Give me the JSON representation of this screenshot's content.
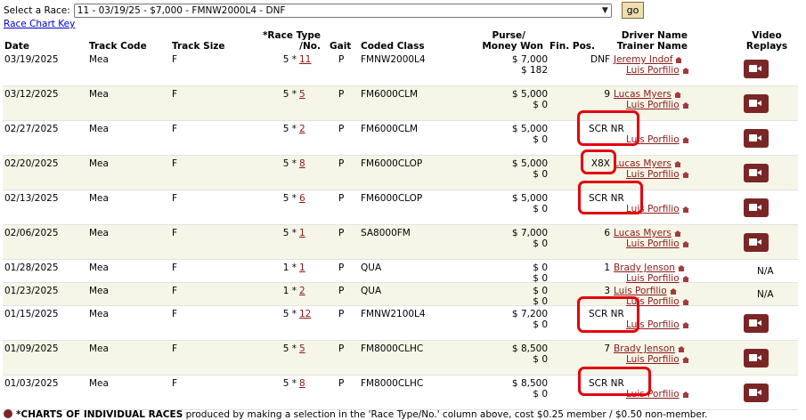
{
  "selector": {
    "label": "Select a Race:",
    "value": "11 - 03/19/25 - $7,000 - FMNW2000L4 - DNF",
    "go": "go"
  },
  "chart_key_link": "Race Chart Key",
  "headers": {
    "date": "Date",
    "track_code": "Track Code",
    "track_size": "Track Size",
    "race_type_1": "*Race Type",
    "race_type_2": "/No.",
    "gait": "Gait",
    "coded_class": "Coded Class",
    "purse_1": "Purse/",
    "purse_2": "Money Won",
    "fin_pos": "Fin. Pos.",
    "driver_1": "Driver Name",
    "driver_2": "Trainer Name",
    "video_1": "Video",
    "video_2": "Replays"
  },
  "rows": [
    {
      "date": "03/19/2025",
      "track": "Mea",
      "size": "F",
      "rt": "5 *",
      "no": "11",
      "gait": "P",
      "cls": "FMNW2000L4",
      "purse": "$ 7,000",
      "won": "$ 182",
      "fin": "DNF",
      "driver": "Jeremy Indof",
      "trainer": "Luis Porfilio",
      "video": true
    },
    {
      "date": "03/12/2025",
      "track": "Mea",
      "size": "F",
      "rt": "5 *",
      "no": "5",
      "gait": "P",
      "cls": "FM6000CLM",
      "purse": "$ 5,000",
      "won": "$ 0",
      "fin": "9",
      "driver": "Lucas Myers",
      "trainer": "Luis Porfilio",
      "video": true
    },
    {
      "date": "02/27/2025",
      "track": "Mea",
      "size": "F",
      "rt": "5 *",
      "no": "2",
      "gait": "P",
      "cls": "FM6000CLM",
      "purse": "$ 5,000",
      "won": "$ 0",
      "fin": "SCR NR",
      "driver": "",
      "trainer": "Luis Porfilio",
      "video": true
    },
    {
      "date": "02/20/2025",
      "track": "Mea",
      "size": "F",
      "rt": "5 *",
      "no": "8",
      "gait": "P",
      "cls": "FM6000CLOP",
      "purse": "$ 5,000",
      "won": "$ 0",
      "fin": "X8X",
      "driver": "Lucas Myers",
      "trainer": "Luis Porfilio",
      "video": true
    },
    {
      "date": "02/13/2025",
      "track": "Mea",
      "size": "F",
      "rt": "5 *",
      "no": "6",
      "gait": "P",
      "cls": "FM6000CLOP",
      "purse": "$ 5,000",
      "won": "$ 0",
      "fin": "SCR NR",
      "driver": "",
      "trainer": "Luis Porfilio",
      "video": true
    },
    {
      "date": "02/06/2025",
      "track": "Mea",
      "size": "F",
      "rt": "5 *",
      "no": "1",
      "gait": "P",
      "cls": "SA8000FM",
      "purse": "$ 7,000",
      "won": "$ 0",
      "fin": "6",
      "driver": "Lucas Myers",
      "trainer": "Luis Porfilio",
      "video": true
    },
    {
      "date": "01/28/2025",
      "track": "Mea",
      "size": "F",
      "rt": "1 *",
      "no": "1",
      "gait": "P",
      "cls": "QUA",
      "purse": "$ 0",
      "won": "$ 0",
      "fin": "1",
      "driver": "Brady Jenson",
      "trainer": "Luis Porfilio",
      "video": false,
      "na": "N/A"
    },
    {
      "date": "01/23/2025",
      "track": "Mea",
      "size": "F",
      "rt": "1 *",
      "no": "2",
      "gait": "P",
      "cls": "QUA",
      "purse": "$ 0",
      "won": "$ 0",
      "fin": "3",
      "driver": "Luis Porfilio",
      "trainer": "Luis Porfilio",
      "video": false,
      "na": "N/A"
    },
    {
      "date": "01/15/2025",
      "track": "Mea",
      "size": "F",
      "rt": "5 *",
      "no": "12",
      "gait": "P",
      "cls": "FMNW2100L4",
      "purse": "$ 7,200",
      "won": "$ 0",
      "fin": "SCR NR",
      "driver": "",
      "trainer": "Luis Porfilio",
      "video": true
    },
    {
      "date": "01/09/2025",
      "track": "Mea",
      "size": "F",
      "rt": "5 *",
      "no": "5",
      "gait": "P",
      "cls": "FM8000CLHC",
      "purse": "$ 8,500",
      "won": "$ 0",
      "fin": "7",
      "driver": "Brady Jenson",
      "trainer": "Luis Porfilio",
      "video": true
    },
    {
      "date": "01/03/2025",
      "track": "Mea",
      "size": "F",
      "rt": "5 *",
      "no": "8",
      "gait": "P",
      "cls": "FM8000CLHC",
      "purse": "$ 8,500",
      "won": "$ 0",
      "fin": "SCR NR",
      "driver": "",
      "trainer": "Luis Porfilio",
      "video": true
    }
  ],
  "footer": {
    "bold": "*CHARTS OF INDIVIDUAL RACES",
    "rest": " produced by making a selection in the 'Race Type/No.' column above, cost $0.25 member / $0.50 non-member."
  },
  "colors": {
    "accent": "#7a2626",
    "annotation": "#e3000b",
    "link": "#8b1a1a"
  }
}
